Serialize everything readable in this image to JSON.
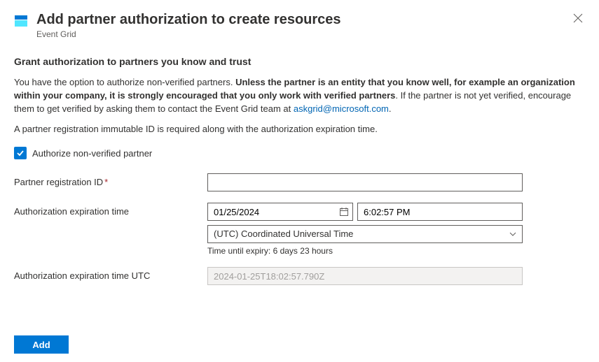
{
  "header": {
    "title": "Add partner authorization to create resources",
    "subtitle": "Event Grid"
  },
  "section_heading": "Grant authorization to partners you know and trust",
  "description": {
    "part1": "You have the option to authorize non-verified partners. ",
    "bold": "Unless the partner is an entity that you know well, for example an organization within your company, it is strongly encouraged that you only work with verified partners",
    "part2": ". If the partner is not yet verified, encourage them to get verified by asking them to contact the Event Grid team at ",
    "link_text": "askgrid@microsoft.com",
    "part3": "."
  },
  "description2": "A partner registration immutable ID is required along with the authorization expiration time.",
  "checkbox_label": "Authorize non-verified partner",
  "fields": {
    "partner_id_label": "Partner registration ID",
    "partner_id_value": "",
    "expiration_label": "Authorization expiration time",
    "date_value": "01/25/2024",
    "time_value": "6:02:57 PM",
    "timezone_value": "(UTC) Coordinated Universal Time",
    "expiry_note": "Time until expiry: 6 days 23 hours",
    "expiration_utc_label": "Authorization expiration time UTC",
    "expiration_utc_value": "2024-01-25T18:02:57.790Z"
  },
  "footer": {
    "add_label": "Add"
  }
}
